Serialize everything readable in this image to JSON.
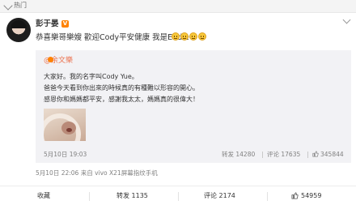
{
  "header": {
    "section_label": "热门"
  },
  "post": {
    "author": "彭于晏",
    "verified_badge": "V",
    "text": "恭喜樂哥樂嫂 歡迎Cody平安健康 我是Eddie",
    "emoji_count": 4,
    "meta": "5月10日 22:06 来自 vivo X21屏幕指纹手机"
  },
  "repost": {
    "author": "@余文樂",
    "lines": [
      "大家好。我的名字叫Cody Yue。",
      "爸爸今天看到你出來的時候真的有種難以形容的開心。",
      "感恩你和媽媽都平安，感謝我太太，媽媽真的很偉大！"
    ],
    "date": "5月10日 19:03",
    "share_label": "转发 14280",
    "comment_label": "评论 17635",
    "like_label": "345844"
  },
  "actions": {
    "favorite": "收藏",
    "share": "转发 1135",
    "comment": "评论 2174",
    "like": "54959"
  },
  "colors": {
    "accent": "#eb7350",
    "badge": "#ff8200",
    "card_bg": "#f2f2f5"
  }
}
